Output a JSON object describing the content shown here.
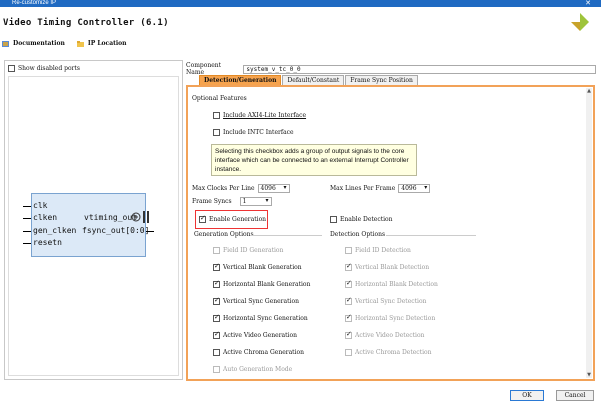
{
  "window": {
    "title": "Re-customize IP",
    "close_glyph": "✕"
  },
  "header": {
    "title": "Video Timing Controller (6.1)",
    "logo_icon": "xilinx-logo-icon"
  },
  "links": {
    "documentation": "Documentation",
    "ip_location": "IP Location"
  },
  "left": {
    "show_disabled_ports": "Show disabled ports",
    "ports_left": [
      "clk",
      "clken",
      "gen_clken",
      "resetn"
    ],
    "ports_right": [
      "vtiming_out",
      "fsync_out[0:0]"
    ]
  },
  "right": {
    "component_name_label": "Component Name",
    "component_name_value": "system_v_tc_0_0",
    "tabs": [
      "Detection/Generation",
      "Default/Constant",
      "Frame Sync Position"
    ],
    "optional_features": "Optional Features",
    "include_axi4_lite": "Include AXI4-Lite Interface",
    "include_intc": "Include INTC Interface",
    "tooltip": "Selecting this checkbox adds a group of output signals to the core interface which can be connected to an external Interrupt Controller instance.",
    "max_clocks_label": "Max Clocks Per Line",
    "max_clocks_value": "4096",
    "max_lines_label": "Max Lines Per Frame",
    "max_lines_value": "4096",
    "frame_syncs_label": "Frame Syncs",
    "frame_syncs_value": "1",
    "enable_generation": "Enable Generation",
    "enable_detection": "Enable Detection",
    "generation_options": "Generation Options",
    "detection_options": "Detection Options",
    "gen_items": [
      "Field ID Generation",
      "Vertical Blank Generation",
      "Horizontal Blank Generation",
      "Vertical Sync Generation",
      "Horizontal Sync Generation",
      "Active Video Generation",
      "Active Chroma Generation",
      "Auto Generation Mode"
    ],
    "det_items": [
      "Field ID Detection",
      "Vertical Blank Detection",
      "Horizontal Blank Detection",
      "Vertical Sync Detection",
      "Horizontal Sync Detection",
      "Active Video Detection",
      "Active Chroma Detection"
    ]
  },
  "buttons": {
    "ok": "OK",
    "cancel": "Cancel"
  },
  "colors": {
    "accent": "#f6a34e",
    "titlebar": "#1f6ac2",
    "highlight": "#ee3333"
  }
}
